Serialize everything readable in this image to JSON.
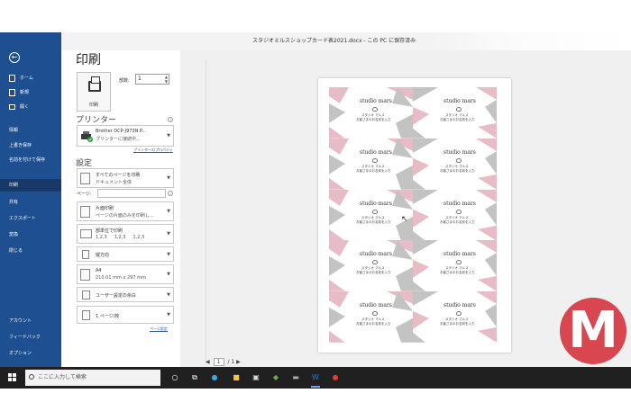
{
  "window": {
    "title": "スタジオミルスショップカード表2021.docx - この PC に保存済み"
  },
  "nav": {
    "back_icon": "arrow-left-circle-icon",
    "items": [
      {
        "label": "ホーム"
      },
      {
        "label": "新規"
      },
      {
        "label": "開く"
      },
      {
        "label": "情報"
      },
      {
        "label": "上書き保存"
      },
      {
        "label": "名前を付けて保存"
      },
      {
        "label": "印刷"
      },
      {
        "label": "共有"
      },
      {
        "label": "エクスポート"
      },
      {
        "label": "変換"
      },
      {
        "label": "閉じる"
      }
    ],
    "bottom_items": [
      {
        "label": "アカウント"
      },
      {
        "label": "フィードバック"
      },
      {
        "label": "オプション"
      }
    ],
    "active_color": "#16396a",
    "bg_color": "#1d4f91"
  },
  "print": {
    "heading": "印刷",
    "print_button": "印刷",
    "copies_label": "部数:",
    "copies_value": "1",
    "printer_title": "プリンター",
    "printer_name": "Brother DCP-J973N P...",
    "printer_status": "プリンターに接続中...",
    "printer_props": "プリンターのプロパティ",
    "settings_title": "設定",
    "pages_label": "ページ:",
    "settings": [
      {
        "line1": "すべてのページを印刷",
        "line2": "ドキュメント全体",
        "icon": "document-stack-icon"
      },
      {
        "line1": "片面印刷",
        "line2": "ページの片面のみを印刷し...",
        "icon": "single-side-icon"
      },
      {
        "line1": "部単位で印刷",
        "line2_parts": [
          "1,2,3",
          "1,2,3",
          "1,2,3"
        ],
        "icon": "collate-icon"
      },
      {
        "line1": "縦方向",
        "icon": "portrait-icon"
      },
      {
        "line1": "A4",
        "line2": "210.01 mm x 297 mm",
        "icon": "paper-size-icon"
      },
      {
        "line1": "ユーザー設定の余白",
        "icon": "margins-icon"
      },
      {
        "line1": "1 ページ/枚",
        "icon": "pages-per-sheet-icon"
      }
    ],
    "page_setup_link": "ページ設定"
  },
  "preview": {
    "page_current": "1",
    "page_total": "/ 1",
    "cards": {
      "brand": "studio mars",
      "line1": "スタジオ マルス",
      "line2": "お客さまのお名前を入力"
    },
    "colors": {
      "pink": "#e7bcc6",
      "gray": "#c3c3c3"
    }
  },
  "taskbar": {
    "search_placeholder": "ここに入力して検索",
    "icons": [
      "start-icon",
      "search-icon",
      "cortana-icon",
      "task-view-icon",
      "edge-icon",
      "file-explorer-icon",
      "store-icon",
      "generic-app-icon",
      "word-icon",
      "app-red-icon"
    ]
  },
  "watermark": {
    "letter": "M",
    "color": "#d8474f"
  }
}
